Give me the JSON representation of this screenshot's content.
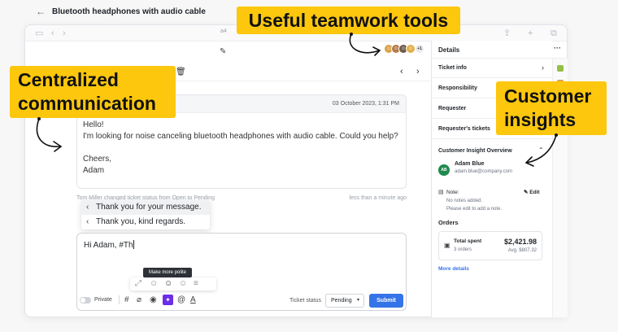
{
  "browser": {
    "url": "a4"
  },
  "ticket": {
    "title": "Bluetooth headphones with audio cable",
    "collaborator_count": "+1"
  },
  "message": {
    "date": "03 October 2023, 1:31 PM",
    "greeting": "Hello!",
    "body": "I'm looking for noise canceling bluetooth headphones with audio cable. Could you help?",
    "signoff": "Cheers,",
    "signature": "Adam"
  },
  "system_event": {
    "text": "Tom Miller changed ticket status from Open to Pending",
    "time": "less than a minute ago"
  },
  "suggestions": [
    {
      "label": "Thank you for your message."
    },
    {
      "label": "Thank you, kind regards."
    }
  ],
  "reply": {
    "text": "Hi Adam, #Th"
  },
  "tone_tooltip": "Make more polite",
  "compose": {
    "private_label": "Private",
    "status_label": "Ticket status",
    "status_value": "Pending",
    "submit_label": "Submit"
  },
  "details_panel": {
    "title": "Details",
    "sections": [
      "Ticket info",
      "Responsibility",
      "Requester",
      "Requester's tickets"
    ],
    "insight_title": "Customer Insight Overview",
    "customer": {
      "initials": "AB",
      "name": "Adam Blue",
      "email": "adam.blue@company.com"
    },
    "note": {
      "label": "Note:",
      "edit": "Edit",
      "line1": "No notes added.",
      "line2": "Please edit to add a note."
    },
    "orders": {
      "label": "Orders",
      "total_label": "Total spent",
      "count": "3 orders",
      "total": "$2,421.98",
      "average": "Avg. $807.32"
    },
    "more_details": "More details"
  },
  "callouts": {
    "teamwork": "Useful teamwork tools",
    "communication_line1": "Centralized",
    "communication_line2": "communication",
    "insights_line1": "Customer",
    "insights_line2": "insights"
  },
  "colors": {
    "callout": "#fcc70d",
    "primary_button": "#3574e8",
    "magic_button": "#6b2ee8",
    "customer_avatar": "#1f8a4c"
  }
}
